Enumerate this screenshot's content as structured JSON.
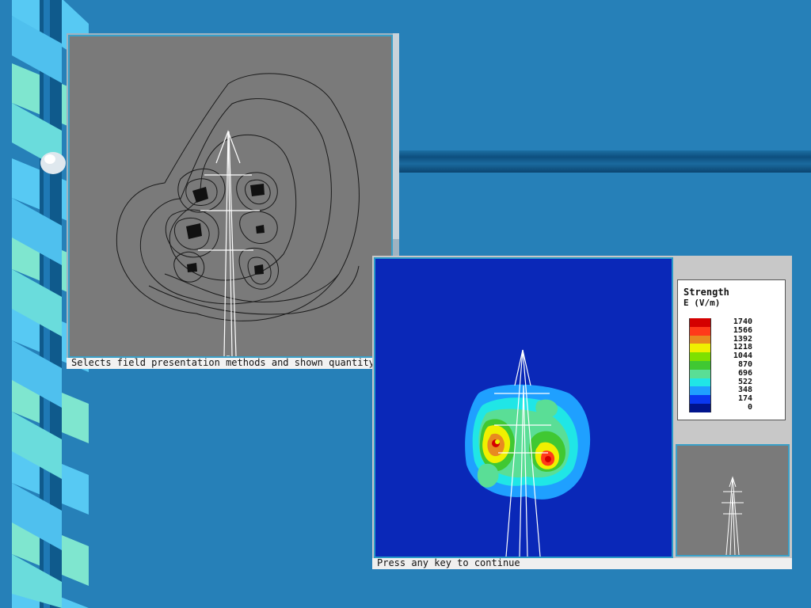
{
  "window1": {
    "status_text": "Selects field presentation methods and shown quantity"
  },
  "window2": {
    "status_text": "Press any key to continue",
    "legend": {
      "title": "Strength",
      "unit": "E (V/m)",
      "levels": [
        {
          "value": "1740",
          "color": "#d40000"
        },
        {
          "value": "1566",
          "color": "#ff3a1a"
        },
        {
          "value": "1392",
          "color": "#e88a20"
        },
        {
          "value": "1218",
          "color": "#f0f000"
        },
        {
          "value": "1044",
          "color": "#7fe000"
        },
        {
          "value": "870",
          "color": "#40c832"
        },
        {
          "value": "696",
          "color": "#5ade96"
        },
        {
          "value": "522",
          "color": "#20e6e6"
        },
        {
          "value": "348",
          "color": "#1fa0ff"
        },
        {
          "value": "174",
          "color": "#0a38f0"
        },
        {
          "value": "0",
          "color": "#00148c"
        }
      ]
    }
  },
  "colors": {
    "background": "#2680b8",
    "plot_background": "#0a28b8",
    "contour_background": "#7a7a7a"
  }
}
